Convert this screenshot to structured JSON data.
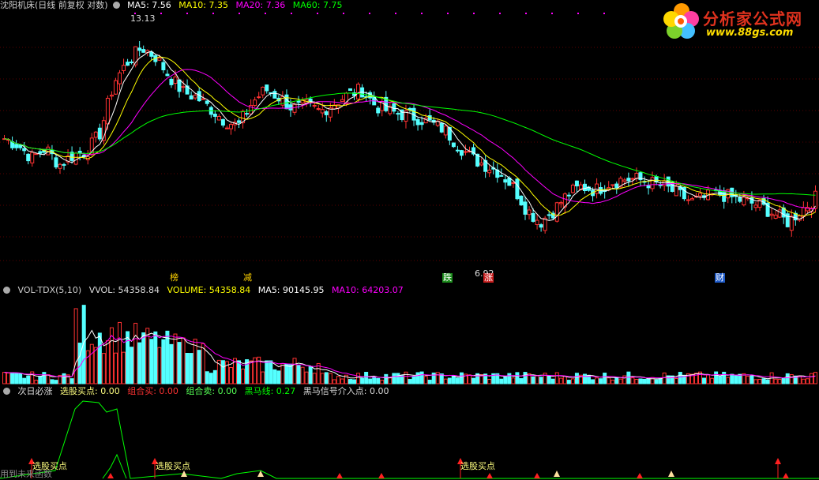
{
  "price": {
    "title": "沈阳机床(日线 前复权 对数)",
    "ma5": "MA5: 7.56",
    "ma10": "MA10: 7.35",
    "ma20": "MA20: 7.36",
    "ma60": "MA60: 7.75",
    "high_label": "13.13",
    "low_label": "6.92",
    "tags": [
      "榜",
      "减",
      "跌",
      "涨",
      "财"
    ]
  },
  "volume": {
    "title": "VOL-TDX(5,10)",
    "vvol": "VVOL: 54358.84",
    "volume": "VOLUME: 54358.84",
    "ma5": "MA5: 90145.95",
    "ma10": "MA10: 64203.07"
  },
  "indicator": {
    "title": "次日必涨",
    "pick": "选股买点: 0.00",
    "combo_buy": "组合买: 0.00",
    "combo_sell": "组合卖: 0.00",
    "black_horse": "黑马线: 0.27",
    "black_horse_signal": "黑马信号介入点: 0.00",
    "buy_labels": [
      "选股买点",
      "选股买点",
      "选股买点"
    ],
    "caption": "用到未来函数"
  },
  "logo": {
    "brand": "分析家公式网",
    "url": "www.88gs.com"
  },
  "colors": {
    "background": "#000000",
    "up": "#ff3232",
    "down": "#54ffff",
    "ma5": "#ffffff",
    "ma10": "#ffff00",
    "ma20": "#ff00ff",
    "ma60": "#00ff00",
    "divider": "#8b0000"
  },
  "chart_data": {
    "type": "candlestick",
    "price_range": [
      5.8,
      14.2
    ],
    "ohlc_close_approx": [
      9.2,
      9.0,
      8.6,
      8.9,
      8.4,
      8.7,
      8.8,
      9.4,
      11.2,
      12.0,
      12.6,
      12.2,
      11.4,
      10.8,
      10.6,
      10.2,
      9.8,
      9.6,
      10.4,
      10.9,
      10.6,
      10.2,
      10.3,
      10.1,
      10.4,
      10.7,
      10.9,
      10.3,
      10.1,
      10.0,
      9.9,
      9.7,
      9.5,
      9.0,
      8.6,
      8.4,
      8.2,
      7.8,
      7.2,
      6.9,
      7.2,
      7.6,
      7.8,
      7.7,
      7.9,
      8.0,
      8.0,
      7.9,
      7.8,
      7.6,
      7.4,
      7.5,
      7.6,
      7.5,
      7.4,
      7.3,
      7.1,
      6.9,
      7.2,
      7.5
    ]
  }
}
